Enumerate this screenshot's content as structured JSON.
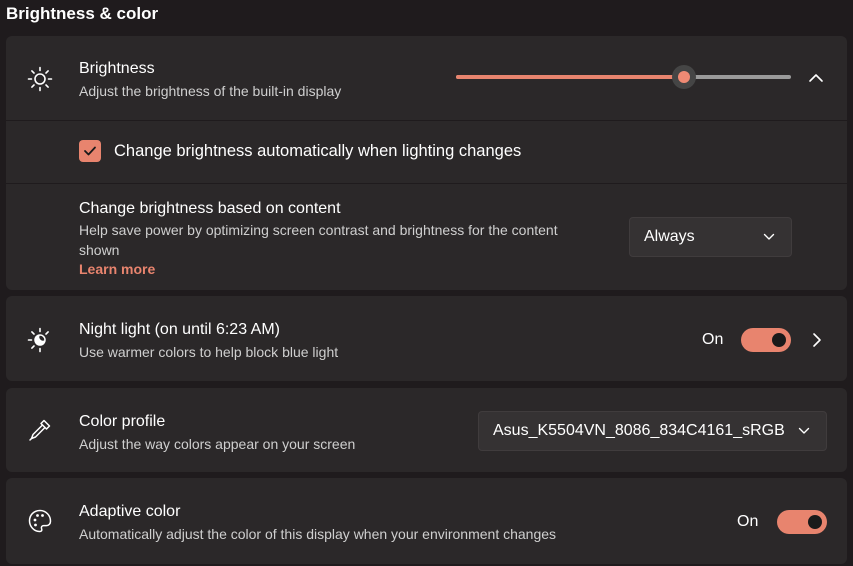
{
  "section_title": "Brightness & color",
  "colors": {
    "accent": "#e8846e",
    "card": "#2b2829",
    "background": "#1f1b1d"
  },
  "brightness": {
    "icon": "sun-icon",
    "title": "Brightness",
    "description": "Adjust the brightness of the built-in display",
    "level": 0.68,
    "expanded": true,
    "auto_change": {
      "label": "Change brightness automatically when lighting changes",
      "checked": true
    },
    "content_based": {
      "title": "Change brightness based on content",
      "description": "Help save power by optimizing screen contrast and brightness for the content shown",
      "link": "Learn more",
      "selected": "Always"
    }
  },
  "night_light": {
    "icon": "night-light-icon",
    "title": "Night light (on until 6:23 AM)",
    "description": "Use warmer colors to help block blue light",
    "state": "On",
    "on": true
  },
  "color_profile": {
    "icon": "eyedropper-icon",
    "title": "Color profile",
    "description": "Adjust the way colors appear on your screen",
    "selected": "Asus_K5504VN_8086_834C4161_sRGB"
  },
  "adaptive_color": {
    "icon": "palette-icon",
    "title": "Adaptive color",
    "description": "Automatically adjust the color of this display when your environment changes",
    "state": "On",
    "on": true
  }
}
